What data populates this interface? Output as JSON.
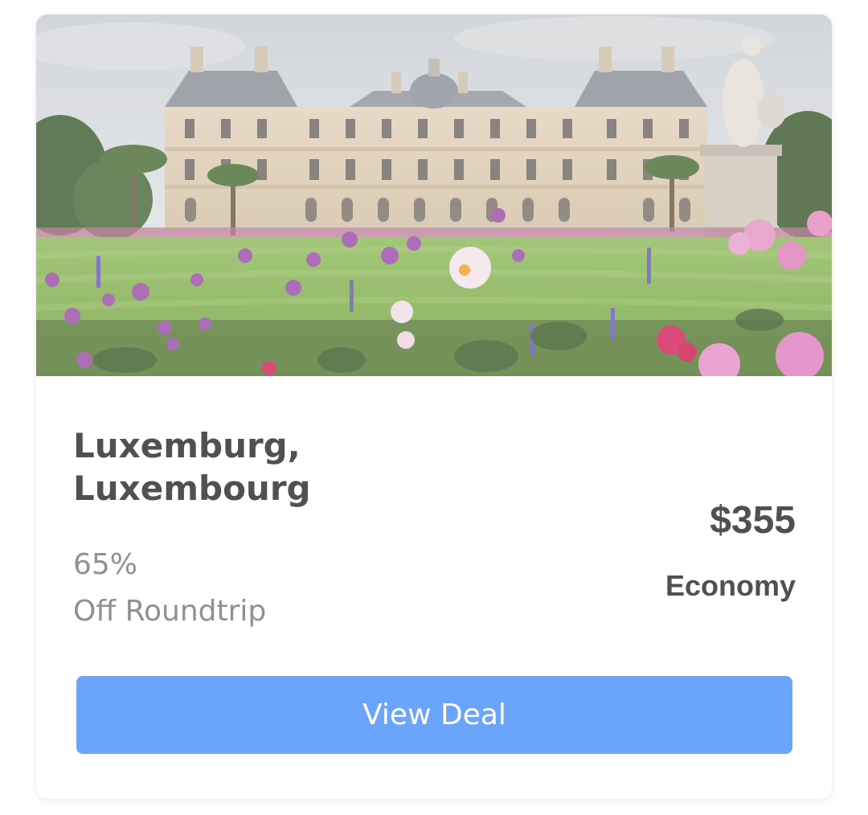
{
  "deal": {
    "image": {
      "subject": "luxembourg-palace-garden-photo"
    },
    "destination": "Luxemburg, Luxembourg",
    "discount": "65%",
    "discount_label": "Off Roundtrip",
    "price": "$355",
    "cabin_class": "Economy",
    "cta_label": "View Deal"
  },
  "colors": {
    "title_text": "#505050",
    "muted_text": "#8e9194",
    "button_bg": "#6aa5fb",
    "button_text": "#ffffff",
    "card_bg": "#ffffff"
  }
}
